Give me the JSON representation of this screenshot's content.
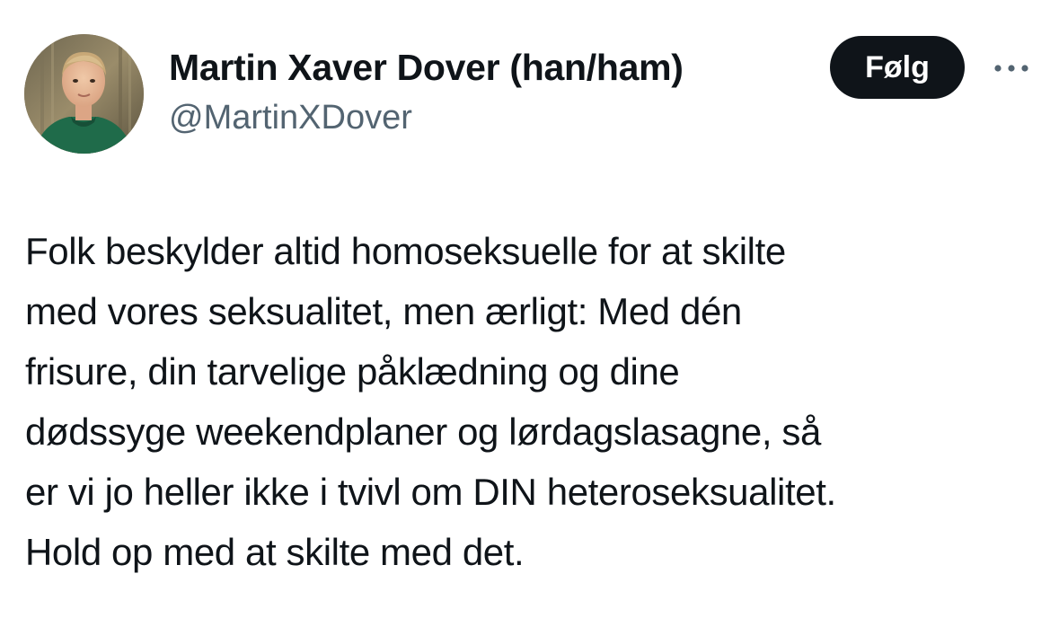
{
  "author": {
    "display_name": "Martin Xaver Dover (han/ham)",
    "handle": "@MartinXDover"
  },
  "actions": {
    "follow_label": "Følg",
    "more_icon": "more-horizontal-icon"
  },
  "tweet": {
    "text": "Folk beskylder altid homoseksuelle for at skilte\nmed vores seksualitet, men ærligt: Med dén\nfrisure, din tarvelige påklædning og dine\ndødssyge weekendplaner og lørdagslasagne, så\ner vi jo heller ikke i tvivl om DIN heteroseksualitet.\nHold op med at skilte med det."
  },
  "colors": {
    "text_primary": "#0f1419",
    "text_secondary": "#536471",
    "follow_bg": "#0f1419",
    "follow_text": "#ffffff",
    "more_dots": "#536471"
  }
}
